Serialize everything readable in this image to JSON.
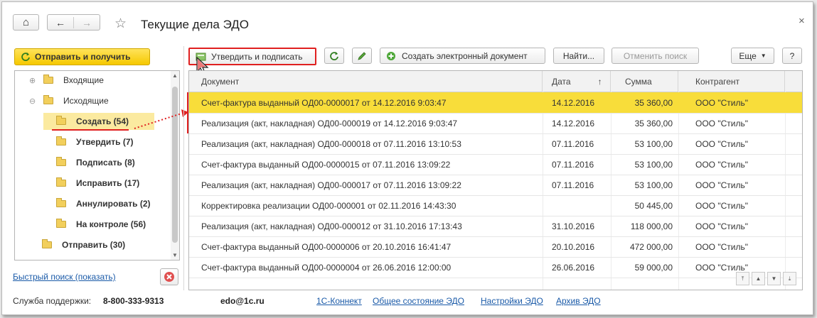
{
  "window": {
    "title": "Текущие дела ЭДО",
    "close_glyph": "×"
  },
  "nav": {
    "home_glyph": "⌂",
    "back_glyph": "←",
    "forward_glyph": "→",
    "star_glyph": "☆"
  },
  "left": {
    "send_receive_label": "Отправить и получить",
    "tree": [
      {
        "label": "Входящие",
        "expander": "⊕",
        "bold": false,
        "selected": false,
        "indent": 0
      },
      {
        "label": "Исходящие",
        "expander": "⊖",
        "bold": false,
        "selected": false,
        "indent": 0
      },
      {
        "label": "Создать (54)",
        "bold": true,
        "selected": true,
        "indent": 1
      },
      {
        "label": "Утвердить (7)",
        "bold": true,
        "selected": false,
        "indent": 1
      },
      {
        "label": "Подписать (8)",
        "bold": true,
        "selected": false,
        "indent": 1
      },
      {
        "label": "Исправить (17)",
        "bold": true,
        "selected": false,
        "indent": 1
      },
      {
        "label": "Аннулировать (2)",
        "bold": true,
        "selected": false,
        "indent": 1
      },
      {
        "label": "На контроле (56)",
        "bold": true,
        "selected": false,
        "indent": 1
      },
      {
        "label": "Отправить (30)",
        "bold": true,
        "selected": false,
        "indent": 0
      }
    ],
    "quick_search_label": "Быстрый поиск (показать)"
  },
  "toolbar": {
    "approve_sign_label": "Утвердить и подписать",
    "create_doc_label": "Создать электронный документ",
    "find_label": "Найти...",
    "cancel_search_label": "Отменить поиск",
    "more_label": "Еще",
    "help_label": "?"
  },
  "table": {
    "columns": {
      "doc": "Документ",
      "date": "Дата",
      "sort_glyph": "↑",
      "sum": "Сумма",
      "counterparty": "Контрагент"
    },
    "rows": [
      {
        "doc": "Счет-фактура выданный ОД00-0000017 от 14.12.2016 9:03:47",
        "date": "14.12.2016",
        "sum": "35 360,00",
        "counterparty": "ООО \"Стиль\"",
        "selected": true
      },
      {
        "doc": "Реализация (акт, накладная) ОД00-000019 от 14.12.2016 9:03:47",
        "date": "14.12.2016",
        "sum": "35 360,00",
        "counterparty": "ООО \"Стиль\""
      },
      {
        "doc": "Реализация (акт, накладная) ОД00-000018 от 07.11.2016 13:10:53",
        "date": "07.11.2016",
        "sum": "53 100,00",
        "counterparty": "ООО \"Стиль\""
      },
      {
        "doc": "Счет-фактура выданный ОД00-0000015 от 07.11.2016 13:09:22",
        "date": "07.11.2016",
        "sum": "53 100,00",
        "counterparty": "ООО \"Стиль\""
      },
      {
        "doc": "Реализация (акт, накладная) ОД00-000017 от 07.11.2016 13:09:22",
        "date": "07.11.2016",
        "sum": "53 100,00",
        "counterparty": "ООО \"Стиль\""
      },
      {
        "doc": "Корректировка реализации ОД00-000001 от 02.11.2016 14:43:30",
        "date": "",
        "sum": "50 445,00",
        "counterparty": "ООО \"Стиль\""
      },
      {
        "doc": "Реализация (акт, накладная) ОД00-000012 от 31.10.2016 17:13:43",
        "date": "31.10.2016",
        "sum": "118 000,00",
        "counterparty": "ООО \"Стиль\""
      },
      {
        "doc": "Счет-фактура выданный ОД00-0000006 от 20.10.2016 16:41:47",
        "date": "20.10.2016",
        "sum": "472 000,00",
        "counterparty": "ООО \"Стиль\""
      },
      {
        "doc": "Счет-фактура выданный ОД00-0000004 от 26.06.2016 12:00:00",
        "date": "26.06.2016",
        "sum": "59 000,00",
        "counterparty": "ООО \"Стиль\""
      }
    ]
  },
  "footer": {
    "support_label": "Служба поддержки:",
    "phone": "8-800-333-9313",
    "email": "edo@1c.ru",
    "links": [
      "1С-Коннект",
      "Общее состояние ЭДО",
      "Настройки ЭДО",
      "Архив ЭДО"
    ]
  },
  "colors": {
    "accent_yellow": "#f8dd3a",
    "highlight_red": "#e02020",
    "link_blue": "#1a5aa8"
  }
}
